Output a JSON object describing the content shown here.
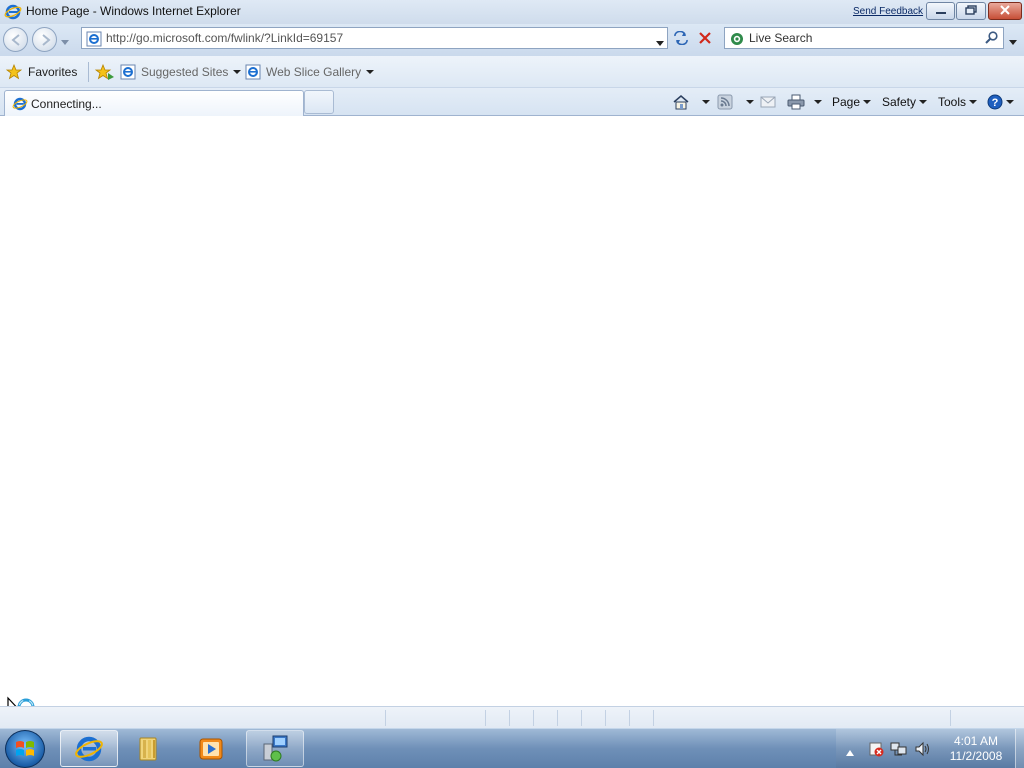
{
  "window": {
    "title": "Home Page - Windows Internet Explorer",
    "send_feedback": "Send Feedback"
  },
  "navigation": {
    "address_value": "http://go.microsoft.com/fwlink/?LinkId=69157",
    "search_placeholder": "Live Search"
  },
  "favorites_bar": {
    "favorites_label": "Favorites",
    "links": [
      {
        "label": "Suggested Sites",
        "icon": "ie-page-icon"
      },
      {
        "label": "Web Slice Gallery",
        "icon": "ie-page-icon"
      }
    ]
  },
  "tabs": [
    {
      "label": "Connecting...",
      "active": true
    }
  ],
  "command_bar": {
    "page_label": "Page",
    "safety_label": "Safety",
    "tools_label": "Tools"
  },
  "taskbar": {
    "apps": [
      "internet-explorer",
      "file-explorer",
      "media-player",
      "network-computer"
    ],
    "clock": {
      "time": "4:01 AM",
      "date": "11/2/2008"
    }
  },
  "colors": {
    "chrome_light": "#dfe9f5",
    "chrome_dark": "#cad9ec",
    "taskbar": "#6f90b8",
    "close_button": "#c74f37",
    "ie_blue": "#1c6fd1"
  }
}
